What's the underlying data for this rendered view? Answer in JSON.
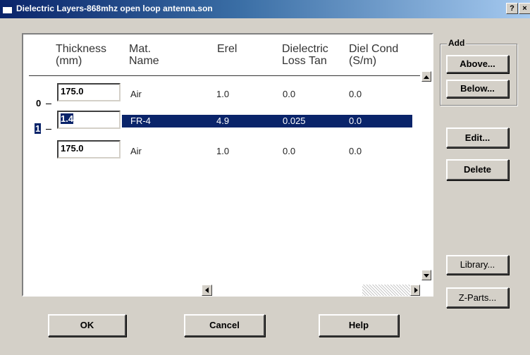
{
  "window": {
    "title": "Dielectric Layers-868mhz open loop antenna.son",
    "help_glyph": "?",
    "close_glyph": "×"
  },
  "columns": [
    {
      "label": "Thickness\n(mm)"
    },
    {
      "label": "Mat.\nName"
    },
    {
      "label": "Erel"
    },
    {
      "label": "Dielectric\nLoss Tan"
    },
    {
      "label": "Diel Cond\n(S/m)"
    }
  ],
  "levels": [
    "0",
    "1"
  ],
  "layers": [
    {
      "thickness": "175.0",
      "material": "Air",
      "erel": "1.0",
      "loss_tan": "0.0",
      "diel_cond": "0.0"
    },
    {
      "thickness": "1.4",
      "material": "FR-4",
      "erel": "4.9",
      "loss_tan": "0.025",
      "diel_cond": "0.0"
    },
    {
      "thickness": "175.0",
      "material": "Air",
      "erel": "1.0",
      "loss_tan": "0.0",
      "diel_cond": "0.0"
    }
  ],
  "selected_row": 1,
  "add_group": {
    "label": "Add",
    "above": "Above...",
    "below": "Below..."
  },
  "buttons": {
    "edit": "Edit...",
    "delete": "Delete",
    "library": "Library...",
    "zparts": "Z-Parts...",
    "ok": "OK",
    "cancel": "Cancel",
    "help": "Help"
  },
  "colors": {
    "selection": "#0a246a",
    "dialog_bg": "#d4d0c8"
  }
}
